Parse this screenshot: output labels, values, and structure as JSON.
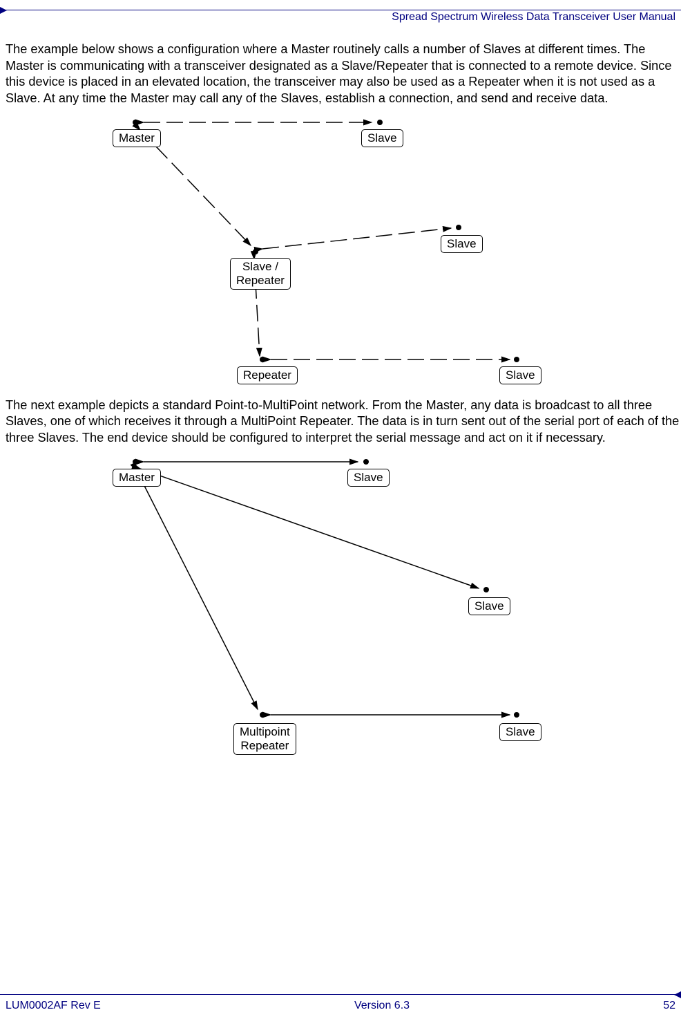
{
  "header": {
    "title": "Spread Spectrum Wireless Data Transceiver User Manual"
  },
  "paragraphs": {
    "p1": "The example below shows a configuration where a Master routinely calls a number of Slaves at different times. The Master is communicating with a transceiver designated as a Slave/Repeater that is connected to a remote device. Since this device is placed in an elevated location, the transceiver may also be used as a Repeater when it is not used as a Slave. At any time the Master may call any of the Slaves, establish a connection, and send and receive data.",
    "p2": "The next example depicts a standard Point-to-MultiPoint network. From the Master, any data is broadcast to all three Slaves, one of which receives it through a MultiPoint Repeater. The data is in turn sent out of the serial port of each of the three Slaves. The end device should be configured to interpret the serial message and act on it if necessary."
  },
  "diagram1": {
    "master": "Master",
    "slave1": "Slave",
    "slave_repeater_l1": "Slave /",
    "slave_repeater_l2": "Repeater",
    "slave2": "Slave",
    "repeater": "Repeater",
    "slave3": "Slave"
  },
  "diagram2": {
    "master": "Master",
    "slave1": "Slave",
    "slave2": "Slave",
    "multipoint_l1": "Multipoint",
    "multipoint_l2": "Repeater",
    "slave3": "Slave"
  },
  "footer": {
    "left": "LUM0002AF Rev E",
    "center": "Version 6.3",
    "right": "52"
  }
}
